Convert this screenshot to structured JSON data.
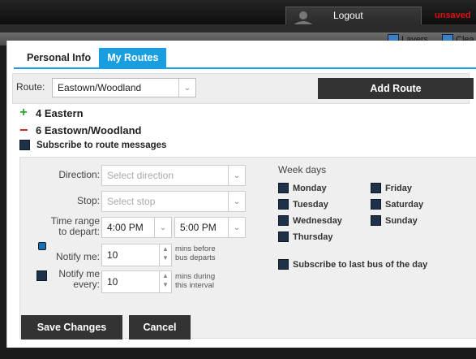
{
  "header": {
    "logout_label": "Logout",
    "unsaved_label": "unsaved",
    "layers_label": "Layers",
    "clear_label": "Clea"
  },
  "tabs": [
    {
      "label": "Personal Info",
      "active": false
    },
    {
      "label": "My Routes",
      "active": true
    }
  ],
  "route_picker": {
    "label": "Route:",
    "selected": "Eastown/Woodland",
    "add_button": "Add Route"
  },
  "routes": [
    {
      "toggle": "+",
      "name": "4 Eastern"
    },
    {
      "toggle": "−",
      "name": "6 Eastown/Woodland"
    }
  ],
  "subscribe_messages": "Subscribe to route messages",
  "details": {
    "direction_label": "Direction:",
    "direction_placeholder": "Select direction",
    "stop_label": "Stop:",
    "stop_placeholder": "Select stop",
    "time_range_label_1": "Time range",
    "time_range_label_2": "to depart:",
    "time_from": "4:00 PM",
    "time_to": "5:00 PM",
    "notify_me_label": "Notify me:",
    "notify_me_value": "10",
    "notify_me_note_1": "mins before",
    "notify_me_note_2": "bus departs",
    "notify_every_label_1": "Notify me",
    "notify_every_label_2": "every:",
    "notify_every_value": "10",
    "notify_every_note_1": "mins during",
    "notify_every_note_2": "this interval",
    "weekdays_title": "Week days",
    "days": [
      "Monday",
      "Tuesday",
      "Wednesday",
      "Thursday",
      "Friday",
      "Saturday",
      "Sunday"
    ],
    "last_bus_label": "Subscribe to last bus of the day",
    "save_button": "Save Changes",
    "cancel_button": "Cancel"
  },
  "colors": {
    "accent": "#1a9ee2",
    "dark_button": "#333333",
    "add": "#2aa82a",
    "remove": "#dd2222",
    "checkbox": "#1e3148"
  }
}
